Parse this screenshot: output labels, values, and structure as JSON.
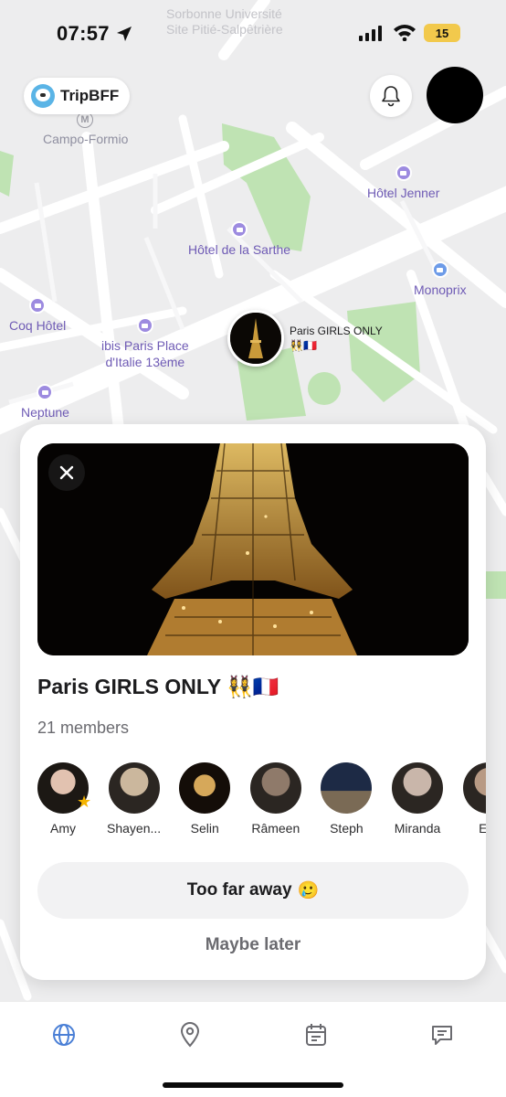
{
  "status_bar": {
    "time": "07:57",
    "battery": "15"
  },
  "header": {
    "app_name": "TripBFF"
  },
  "map": {
    "faded_label": "Sorbonne Université\nSite Pitié-Salpêtrière",
    "metro_symbol": "M",
    "metro_station": "Campo-Formio",
    "pois": {
      "hotel_jenner": "Hôtel Jenner",
      "hotel_sarthe": "Hôtel de la Sarthe",
      "monoprix": "Monoprix",
      "coq_hotel": "Coq Hôtel",
      "ibis": "ibis Paris Place\nd'Italie 13ème",
      "neptune": "Neptune"
    },
    "marker": {
      "name": "Paris GIRLS ONLY",
      "emojis": "👯‍♀️🇫🇷"
    }
  },
  "group_card": {
    "title": "Paris GIRLS ONLY 👯‍♀️🇫🇷",
    "member_count": "21 members",
    "members": [
      {
        "name": "Amy",
        "color": "#d9b8a8"
      },
      {
        "name": "Shayen...",
        "color": "#cbb79d"
      },
      {
        "name": "Selin",
        "color": "#3a2a1c"
      },
      {
        "name": "Râmeen",
        "color": "#8f7a6a"
      },
      {
        "name": "Steph",
        "color": "#2f3a52"
      },
      {
        "name": "Miranda",
        "color": "#c9b6aa"
      },
      {
        "name": "Em",
        "color": "#b89a84"
      }
    ],
    "primary_button": "Too far away",
    "primary_emoji": "🥲",
    "secondary_button": "Maybe later"
  },
  "tabs": [
    {
      "name": "globe-icon",
      "active": true
    },
    {
      "name": "location-pin-icon",
      "active": false
    },
    {
      "name": "calendar-icon",
      "active": false
    },
    {
      "name": "chat-icon",
      "active": false
    }
  ],
  "colors": {
    "accent": "#4a7fd6",
    "poi_purple": "#6f5bb5",
    "park_green": "#bfe3b3"
  }
}
